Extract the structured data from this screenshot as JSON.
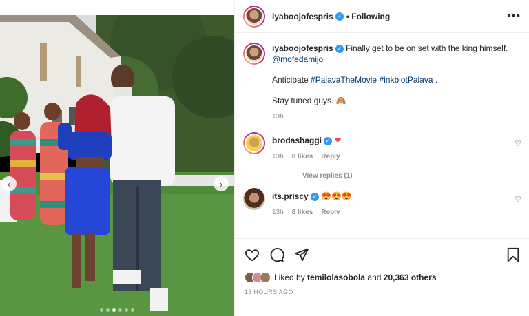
{
  "post": {
    "username": "iyaboojofespris",
    "following_label": "Following",
    "more_label": "•••",
    "carousel": {
      "current": 3,
      "count": 6
    }
  },
  "caption": {
    "username": "iyaboojofespris",
    "text": "Finally get to be on set with the king himself.",
    "mention": "@mofedamijo",
    "anticipate": "Anticipate",
    "hashtag1": "#PalavaTheMovie",
    "hashtag2": "#inkblotPalava",
    "period": ".",
    "stay": "Stay tuned guys.",
    "stay_emoji": "🙈",
    "time": "13h"
  },
  "comments": [
    {
      "username": "brodashaggi",
      "text": "❤",
      "time": "13h",
      "likes": "8 likes",
      "reply": "Reply",
      "view_replies": "View replies (1)"
    },
    {
      "username": "its.priscy",
      "text": "😍😍😍",
      "time": "13h",
      "likes": "8 likes",
      "reply": "Reply"
    }
  ],
  "likes": {
    "prefix": "Liked by",
    "user": "temilolasobola",
    "and": "and",
    "count": "20,363 others"
  },
  "timestamp": "13 HOURS AGO",
  "colors": {
    "verified": "#3897f0",
    "link": "#00376b",
    "heart": "#ed4956"
  }
}
